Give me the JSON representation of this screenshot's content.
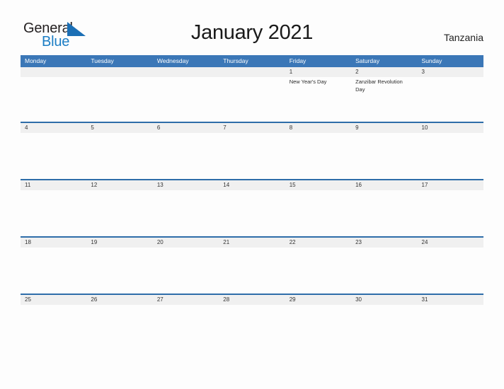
{
  "header": {
    "logo": {
      "text_primary": "General",
      "text_secondary": "Blue",
      "flag_icon": "blue-triangle-flag-icon",
      "flag_color": "#1B6FB5"
    },
    "title": "January 2021",
    "region": "Tanzania"
  },
  "colors": {
    "header_blue": "#3B77B7",
    "separator_blue": "#2E6DA9",
    "date_strip_gray": "#F0F0F0",
    "logo_blue": "#1B7DC4",
    "page_background": "#FDFDFD"
  },
  "calendar": {
    "month": "January",
    "year": "2021",
    "weekday_headers": [
      "Monday",
      "Tuesday",
      "Wednesday",
      "Thursday",
      "Friday",
      "Saturday",
      "Sunday"
    ],
    "weeks": [
      {
        "days": [
          {
            "date": "",
            "events": []
          },
          {
            "date": "",
            "events": []
          },
          {
            "date": "",
            "events": []
          },
          {
            "date": "",
            "events": []
          },
          {
            "date": "1",
            "events": [
              "New Year's Day"
            ]
          },
          {
            "date": "2",
            "events": [
              "Zanzibar Revolution Day"
            ]
          },
          {
            "date": "3",
            "events": []
          }
        ]
      },
      {
        "days": [
          {
            "date": "4",
            "events": []
          },
          {
            "date": "5",
            "events": []
          },
          {
            "date": "6",
            "events": []
          },
          {
            "date": "7",
            "events": []
          },
          {
            "date": "8",
            "events": []
          },
          {
            "date": "9",
            "events": []
          },
          {
            "date": "10",
            "events": []
          }
        ]
      },
      {
        "days": [
          {
            "date": "11",
            "events": []
          },
          {
            "date": "12",
            "events": []
          },
          {
            "date": "13",
            "events": []
          },
          {
            "date": "14",
            "events": []
          },
          {
            "date": "15",
            "events": []
          },
          {
            "date": "16",
            "events": []
          },
          {
            "date": "17",
            "events": []
          }
        ]
      },
      {
        "days": [
          {
            "date": "18",
            "events": []
          },
          {
            "date": "19",
            "events": []
          },
          {
            "date": "20",
            "events": []
          },
          {
            "date": "21",
            "events": []
          },
          {
            "date": "22",
            "events": []
          },
          {
            "date": "23",
            "events": []
          },
          {
            "date": "24",
            "events": []
          }
        ]
      },
      {
        "days": [
          {
            "date": "25",
            "events": []
          },
          {
            "date": "26",
            "events": []
          },
          {
            "date": "27",
            "events": []
          },
          {
            "date": "28",
            "events": []
          },
          {
            "date": "29",
            "events": []
          },
          {
            "date": "30",
            "events": []
          },
          {
            "date": "31",
            "events": []
          }
        ]
      }
    ]
  }
}
